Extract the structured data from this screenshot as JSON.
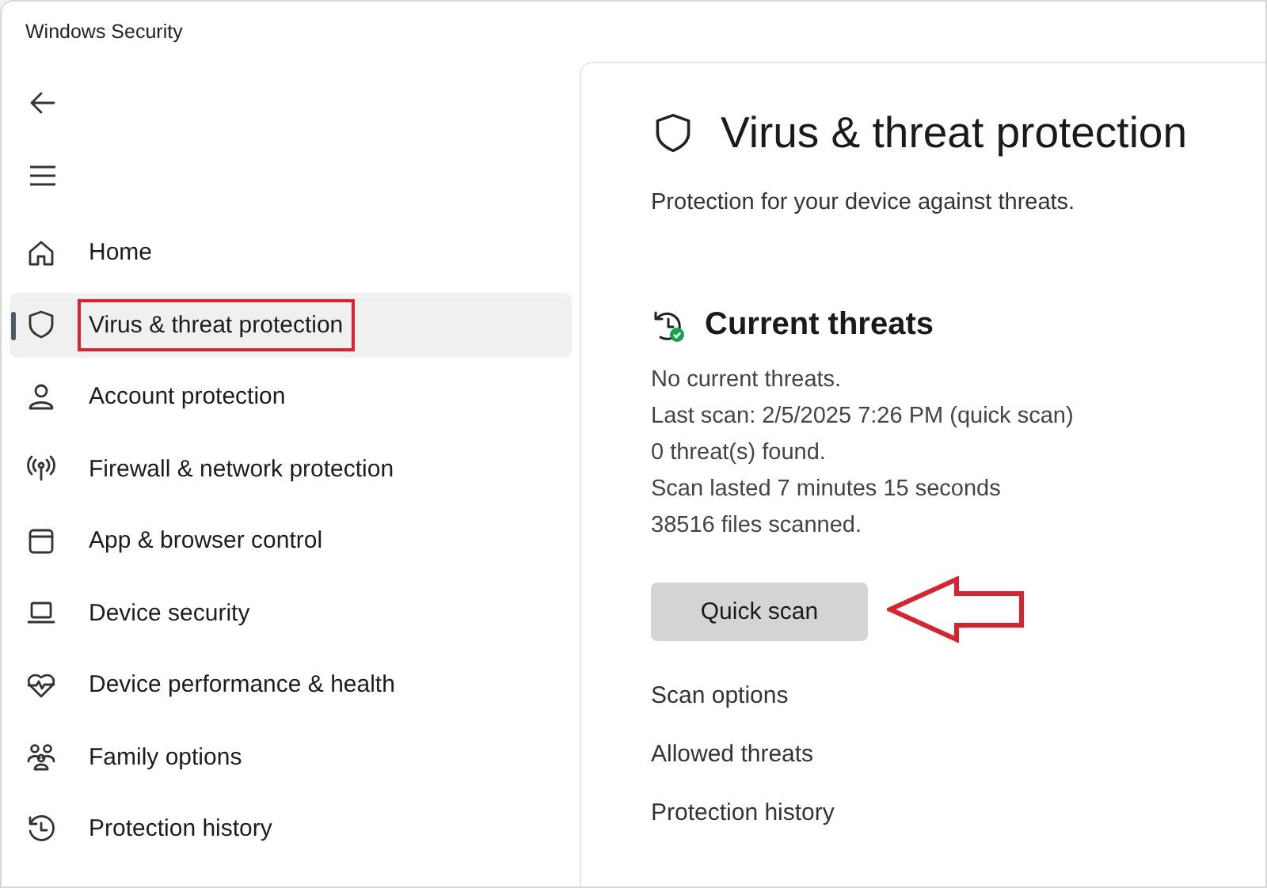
{
  "window": {
    "title": "Windows Security"
  },
  "sidebar": {
    "items": [
      {
        "label": "Home",
        "selected": false,
        "highlighted": false
      },
      {
        "label": "Virus & threat protection",
        "selected": true,
        "highlighted": true
      },
      {
        "label": "Account protection",
        "selected": false,
        "highlighted": false
      },
      {
        "label": "Firewall & network protection",
        "selected": false,
        "highlighted": false
      },
      {
        "label": "App & browser control",
        "selected": false,
        "highlighted": false
      },
      {
        "label": "Device security",
        "selected": false,
        "highlighted": false
      },
      {
        "label": "Device performance & health",
        "selected": false,
        "highlighted": false
      },
      {
        "label": "Family options",
        "selected": false,
        "highlighted": false
      },
      {
        "label": "Protection history",
        "selected": false,
        "highlighted": false
      }
    ]
  },
  "page": {
    "title": "Virus & threat protection",
    "subtitle": "Protection for your device against threats.",
    "section": {
      "title": "Current threats",
      "lines": [
        "No current threats.",
        "Last scan: 2/5/2025 7:26 PM (quick scan)",
        "0 threat(s) found.",
        "Scan lasted 7 minutes 15 seconds",
        "38516 files scanned."
      ],
      "button": {
        "label": "Quick scan",
        "pointed_at": true
      },
      "links": [
        "Scan options",
        "Allowed threats",
        "Protection history"
      ]
    }
  }
}
